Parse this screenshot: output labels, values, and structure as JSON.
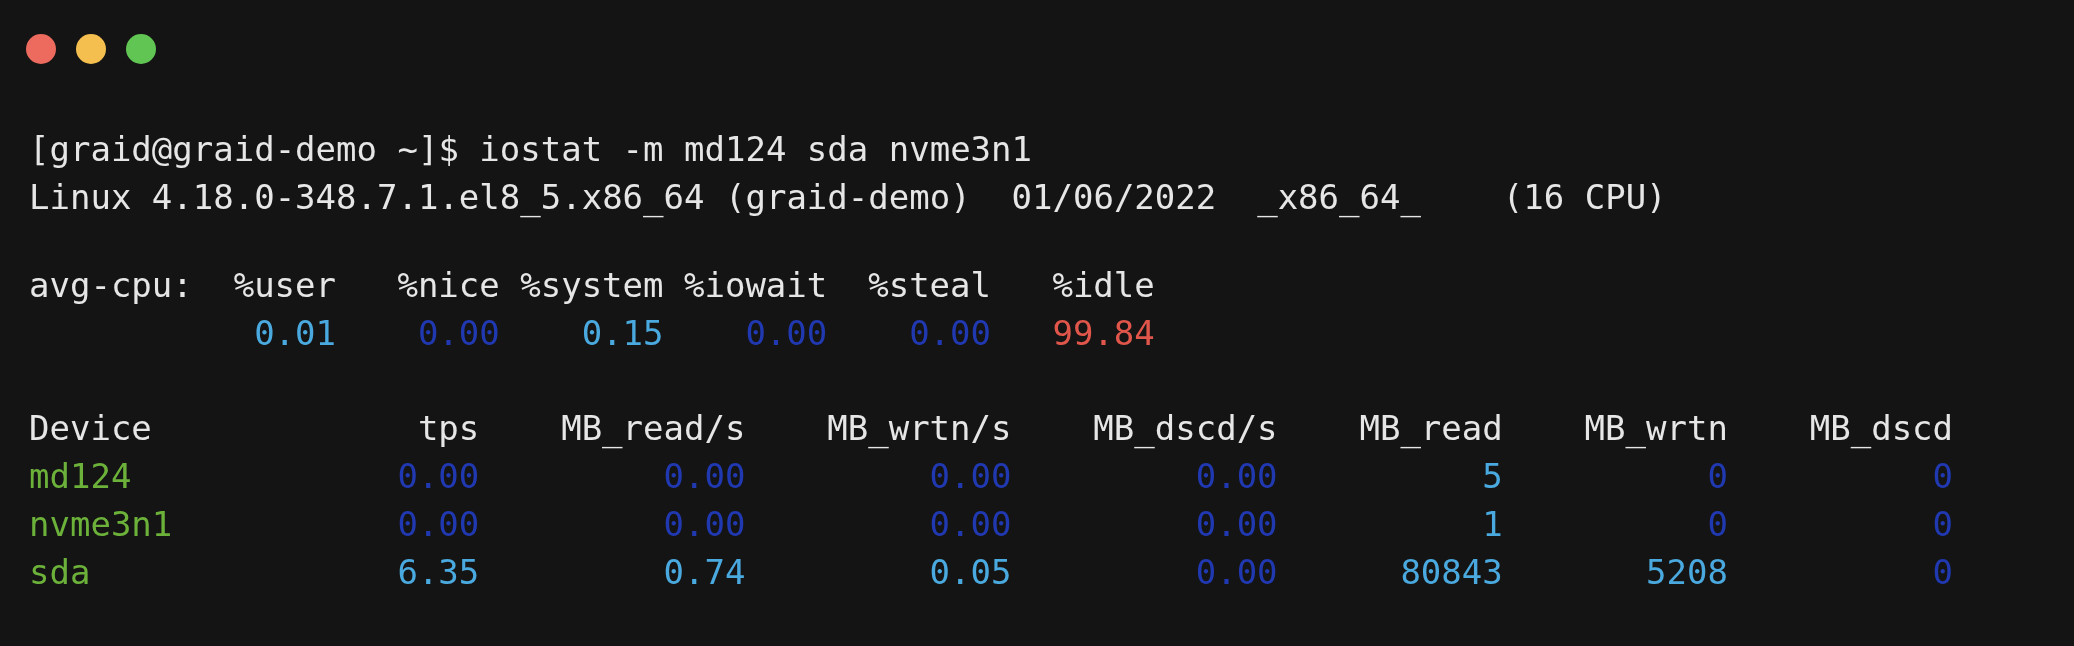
{
  "terminal": {
    "command_line": "[graid@graid-demo ~]$ iostat -m md124 sda nvme3n1",
    "system_line": "Linux 4.18.0-348.7.1.el8_5.x86_64 (graid-demo)  01/06/2022  _x86_64_    (16 CPU)",
    "cpu": {
      "label": "avg-cpu:",
      "columns": [
        "%user",
        "%nice",
        "%system",
        "%iowait",
        "%steal",
        "%idle"
      ],
      "values": [
        {
          "text": "0.01",
          "color": "#4aa9de"
        },
        {
          "text": "0.00",
          "color": "#2038b0"
        },
        {
          "text": "0.15",
          "color": "#4aa9de"
        },
        {
          "text": "0.00",
          "color": "#2038b0"
        },
        {
          "text": "0.00",
          "color": "#2038b0"
        },
        {
          "text": "99.84",
          "color": "#e0564b"
        }
      ]
    },
    "devices": {
      "columns": [
        "Device",
        "tps",
        "MB_read/s",
        "MB_wrtn/s",
        "MB_dscd/s",
        "MB_read",
        "MB_wrtn",
        "MB_dscd"
      ],
      "rows": [
        {
          "cells": [
            {
              "text": "md124",
              "color": "#6cb23a"
            },
            {
              "text": "0.00",
              "color": "#2038b0"
            },
            {
              "text": "0.00",
              "color": "#2038b0"
            },
            {
              "text": "0.00",
              "color": "#2038b0"
            },
            {
              "text": "0.00",
              "color": "#2038b0"
            },
            {
              "text": "5",
              "color": "#4aa9de"
            },
            {
              "text": "0",
              "color": "#2038b0"
            },
            {
              "text": "0",
              "color": "#2038b0"
            }
          ]
        },
        {
          "cells": [
            {
              "text": "nvme3n1",
              "color": "#6cb23a"
            },
            {
              "text": "0.00",
              "color": "#2038b0"
            },
            {
              "text": "0.00",
              "color": "#2038b0"
            },
            {
              "text": "0.00",
              "color": "#2038b0"
            },
            {
              "text": "0.00",
              "color": "#2038b0"
            },
            {
              "text": "1",
              "color": "#4aa9de"
            },
            {
              "text": "0",
              "color": "#2038b0"
            },
            {
              "text": "0",
              "color": "#2038b0"
            }
          ]
        },
        {
          "cells": [
            {
              "text": "sda",
              "color": "#6cb23a"
            },
            {
              "text": "6.35",
              "color": "#4aa9de"
            },
            {
              "text": "0.74",
              "color": "#4aa9de"
            },
            {
              "text": "0.05",
              "color": "#4aa9de"
            },
            {
              "text": "0.00",
              "color": "#2038b0"
            },
            {
              "text": "80843",
              "color": "#4aa9de"
            },
            {
              "text": "5208",
              "color": "#4aa9de"
            },
            {
              "text": "0",
              "color": "#2038b0"
            }
          ]
        }
      ]
    }
  }
}
